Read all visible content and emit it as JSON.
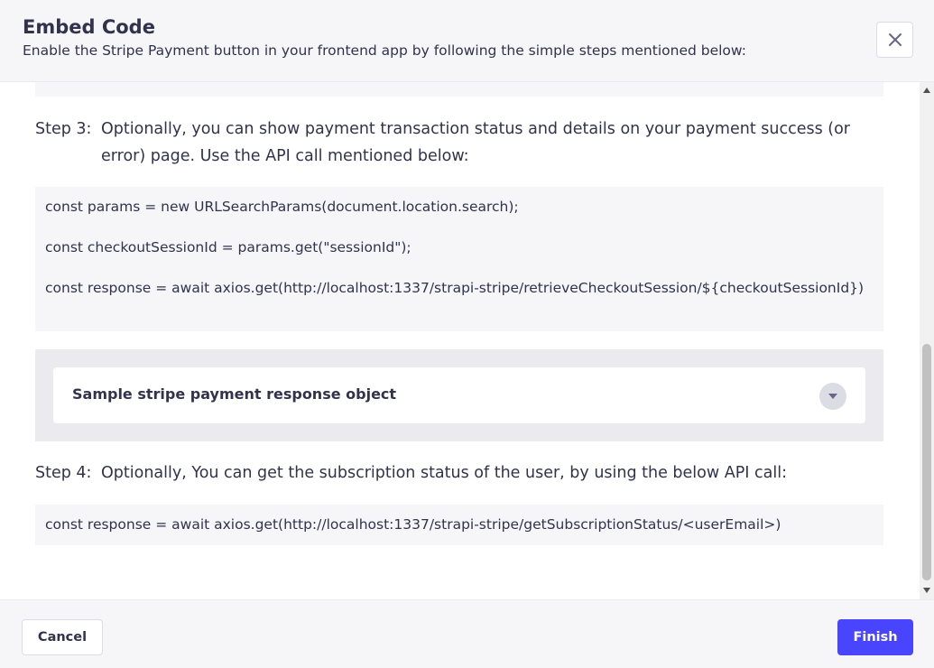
{
  "header": {
    "title": "Embed Code",
    "subtitle": "Enable the Stripe Payment button in your frontend app by following the simple steps mentioned below:",
    "close_icon": "close-icon"
  },
  "step3": {
    "label": "Step 3:",
    "text": "Optionally, you can show payment transaction status and details on your payment success (or error) page. Use the API call mentioned below:"
  },
  "code_block_1": {
    "lines": [
      "const params = new URLSearchParams(document.location.search);",
      "const checkoutSessionId = params.get(\"sessionId\");",
      "const response = await axios.get(http://localhost:1337/strapi-stripe/retrieveCheckoutSession/${checkoutSessionId})"
    ]
  },
  "accordion": {
    "label": "Sample stripe payment response object",
    "icon": "chevron-down-icon",
    "expanded": false
  },
  "step4": {
    "label": "Step 4:",
    "text": "Optionally, You can get the subscription status of the user, by using the below API call:"
  },
  "code_block_2": {
    "line": "const response = await axios.get(http://localhost:1337/strapi-stripe/getSubscriptionStatus/<userEmail>)"
  },
  "footer": {
    "cancel_label": "Cancel",
    "finish_label": "Finish"
  },
  "colors": {
    "primary": "#4945ff",
    "text": "#32324d",
    "neutral_bg": "#f6f6f9"
  }
}
